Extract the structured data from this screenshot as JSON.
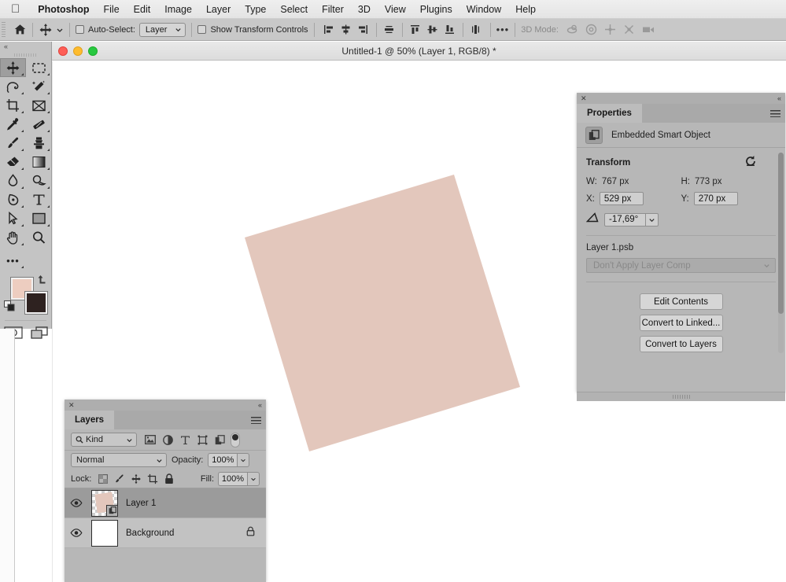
{
  "menubar": {
    "apple_icon": "apple-logo",
    "items": [
      {
        "label": "Photoshop",
        "bold": true
      },
      {
        "label": "File"
      },
      {
        "label": "Edit"
      },
      {
        "label": "Image"
      },
      {
        "label": "Layer"
      },
      {
        "label": "Type"
      },
      {
        "label": "Select"
      },
      {
        "label": "Filter"
      },
      {
        "label": "3D"
      },
      {
        "label": "View"
      },
      {
        "label": "Plugins"
      },
      {
        "label": "Window"
      },
      {
        "label": "Help"
      }
    ]
  },
  "options_bar": {
    "home_icon": "home-icon",
    "tool_icon": "move-tool-icon",
    "auto_select_label": "Auto-Select:",
    "auto_select_checked": false,
    "auto_select_value": "Layer",
    "show_transform_label": "Show Transform Controls",
    "show_transform_checked": false,
    "more_options_label": "•••",
    "three_d_mode_label": "3D Mode:",
    "align_icons": [
      "align-left-edges-icon",
      "align-horizontal-centers-icon",
      "align-right-edges-icon",
      "align-top-edges-icon",
      "align-vertical-centers-icon",
      "align-bottom-edges-icon",
      "distribute-horizontal-icon",
      "distribute-vertical-icon"
    ],
    "three_d_icons": [
      "3d-orbit-icon",
      "3d-roll-icon",
      "3d-pan-icon",
      "3d-slide-icon",
      "3d-camera-icon"
    ]
  },
  "toolbar": {
    "collapse_icon": "collapse-panel-icon",
    "tools": [
      {
        "name": "move-tool",
        "icon": "move-tool-icon",
        "selected": true,
        "has_flyout": true
      },
      {
        "name": "rectangular-marquee-tool",
        "icon": "rectangular-marquee-icon",
        "selected": false,
        "has_flyout": true
      },
      {
        "name": "lasso-tool",
        "icon": "lasso-icon",
        "selected": false,
        "has_flyout": true
      },
      {
        "name": "object-selection-tool",
        "icon": "magic-wand-icon",
        "selected": false,
        "has_flyout": true
      },
      {
        "name": "crop-tool",
        "icon": "crop-icon",
        "selected": false,
        "has_flyout": true
      },
      {
        "name": "frame-tool",
        "icon": "frame-icon",
        "selected": false,
        "has_flyout": true
      },
      {
        "name": "eyedropper-tool",
        "icon": "eyedropper-icon",
        "selected": false,
        "has_flyout": true
      },
      {
        "name": "healing-brush-tool",
        "icon": "healing-brush-icon",
        "selected": false,
        "has_flyout": true
      },
      {
        "name": "brush-tool",
        "icon": "brush-icon",
        "selected": false,
        "has_flyout": true
      },
      {
        "name": "clone-stamp-tool",
        "icon": "clone-stamp-icon",
        "selected": false,
        "has_flyout": true
      },
      {
        "name": "eraser-tool",
        "icon": "eraser-icon",
        "selected": false,
        "has_flyout": true
      },
      {
        "name": "gradient-tool",
        "icon": "gradient-icon",
        "selected": false,
        "has_flyout": true
      },
      {
        "name": "blur-tool",
        "icon": "blur-drop-icon",
        "selected": false,
        "has_flyout": true
      },
      {
        "name": "dodge-tool",
        "icon": "dodge-icon",
        "selected": false,
        "has_flyout": true
      },
      {
        "name": "pen-tool",
        "icon": "pen-icon",
        "selected": false,
        "has_flyout": true
      },
      {
        "name": "type-tool",
        "icon": "type-T-icon",
        "selected": false,
        "has_flyout": true
      },
      {
        "name": "path-selection-tool",
        "icon": "path-arrow-icon",
        "selected": false,
        "has_flyout": true
      },
      {
        "name": "rectangle-tool",
        "icon": "rectangle-shape-icon",
        "selected": false,
        "has_flyout": true
      },
      {
        "name": "hand-tool",
        "icon": "hand-icon",
        "selected": false,
        "has_flyout": true
      },
      {
        "name": "zoom-tool",
        "icon": "magnifier-icon",
        "selected": false,
        "has_flyout": false
      }
    ],
    "edit_toolbar_icon": "more-tools-ellipsis-icon",
    "foreground_color": "#edcdc0",
    "background_color": "#2e2220",
    "swap_colors_icon": "swap-colors-icon",
    "default_colors_icon": "default-colors-icon",
    "quick_mask_icon": "quick-mask-icon",
    "screen_mode_icon": "screen-mode-icon"
  },
  "document": {
    "title": "Untitled-1 @ 50% (Layer 1, RGB/8) *",
    "traffic_lights": [
      "close-button",
      "minimize-button",
      "zoom-button"
    ],
    "canvas_background": "#ffffff",
    "shape": {
      "name": "rotated-square-shape",
      "fill": "#e3c7bc",
      "rotation_deg": -17.69
    }
  },
  "properties_panel": {
    "close_icon": "close-icon",
    "collapse_icon": "collapse-panel-icon",
    "tab_label": "Properties",
    "menu_icon": "panel-menu-icon",
    "object_type_icon": "embedded-smart-object-icon",
    "object_type_label": "Embedded Smart Object",
    "transform": {
      "heading": "Transform",
      "reset_icon": "reset-transform-icon",
      "width_label": "W:",
      "width_value": "767 px",
      "height_label": "H:",
      "height_value": "773 px",
      "x_label": "X:",
      "x_value": "529 px",
      "y_label": "Y:",
      "y_value": "270 px",
      "angle_icon": "angle-icon",
      "angle_value": "-17,69°"
    },
    "source_file": "Layer 1.psb",
    "layer_comp_value": "Don't Apply Layer Comp",
    "buttons": [
      {
        "name": "edit-contents-button",
        "label": "Edit Contents"
      },
      {
        "name": "convert-to-linked-button",
        "label": "Convert to Linked..."
      },
      {
        "name": "convert-to-layers-button",
        "label": "Convert to Layers"
      }
    ]
  },
  "layers_panel": {
    "close_icon": "close-icon",
    "collapse_icon": "collapse-panel-icon",
    "tab_label": "Layers",
    "menu_icon": "panel-menu-icon",
    "filter": {
      "kind_icon": "search-icon",
      "kind_label": "Kind",
      "type_filters": [
        "filter-pixel-layers-icon",
        "filter-adjustment-layers-icon",
        "filter-type-layers-icon",
        "filter-shape-layers-icon",
        "filter-smart-objects-icon"
      ],
      "toggle_name": "filter-enable-toggle"
    },
    "blend_mode": "Normal",
    "opacity_label": "Opacity:",
    "opacity_value": "100%",
    "lock_label": "Lock:",
    "lock_icons": [
      "lock-transparent-pixels-icon",
      "lock-image-pixels-icon",
      "lock-position-icon",
      "lock-artboard-nesting-icon",
      "lock-all-icon"
    ],
    "fill_label": "Fill:",
    "fill_value": "100%",
    "layers": [
      {
        "name": "Layer 1",
        "selected": true,
        "visible": true,
        "locked": false,
        "thumbnail": "smart-object-thumbnail"
      },
      {
        "name": "Background",
        "selected": false,
        "visible": true,
        "locked": true,
        "thumbnail": "white-background-thumbnail"
      }
    ]
  },
  "colors": {
    "menubar_bg": "#e9e9e9",
    "options_bar_bg": "#c8c8c8",
    "panel_bg": "#b7b7b7",
    "toolbar_bg": "#c4c4c4",
    "selected_layer_bg": "#9b9b9b",
    "shape_fill": "#e3c7bc"
  }
}
